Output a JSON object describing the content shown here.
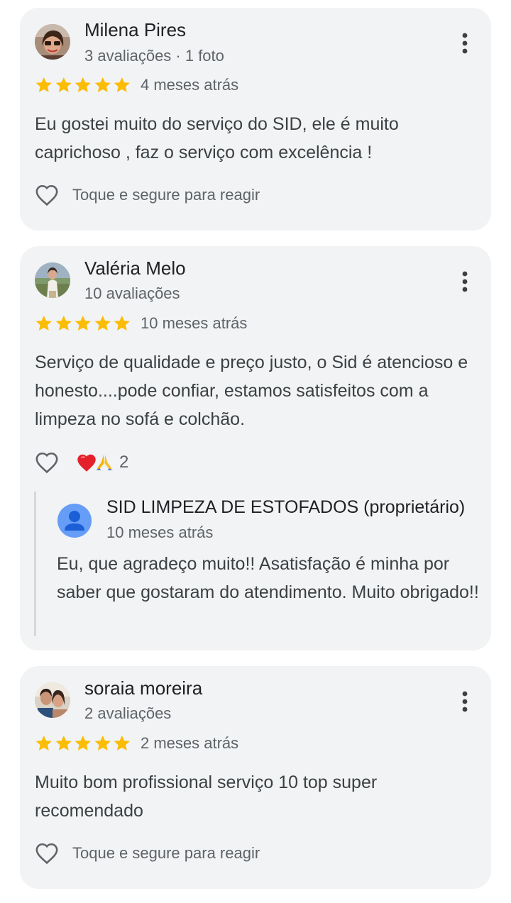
{
  "reviews": [
    {
      "author": "Milena Pires",
      "meta": "3 avaliações · 1 foto",
      "rating": 5,
      "time": "4 meses atrás",
      "text": "Eu gostei muito do serviço do SID, ele é muito caprichoso , faz o serviço com excelência !",
      "react_hint": "Toque e segure para reagir"
    },
    {
      "author": "Valéria Melo",
      "meta": "10 avaliações",
      "rating": 5,
      "time": "10 meses atrás",
      "text": "Serviço de qualidade e preço justo, o Sid é atencioso e honesto....pode confiar, estamos satisfeitos com a limpeza no sofá e colchão.",
      "reactions": {
        "icons": [
          "red-heart",
          "folded-hands"
        ],
        "count": "2"
      },
      "owner_reply": {
        "name": "SID LIMPEZA DE ESTOFADOS (proprietário)",
        "time": "10 meses atrás",
        "text": "Eu, que agradeço muito!! Asatisfação é minha por saber que gostaram do atendimento. Muito obrigado!!"
      }
    },
    {
      "author": "soraia moreira",
      "meta": "2 avaliações",
      "rating": 5,
      "time": "2 meses atrás",
      "text": "Muito bom profissional serviço 10 top super recomendado",
      "react_hint": "Toque e segure para reagir"
    }
  ],
  "colors": {
    "card_background": "#f1f3f4",
    "star": "#fbbc04",
    "primary_text": "#202124",
    "secondary_text": "#5f6368",
    "reply_rule": "#d5d7da",
    "owner_avatar": "#669df6"
  },
  "icons": {
    "more": "more-vert-icon",
    "react": "heart-outline-icon",
    "star": "star-icon"
  }
}
